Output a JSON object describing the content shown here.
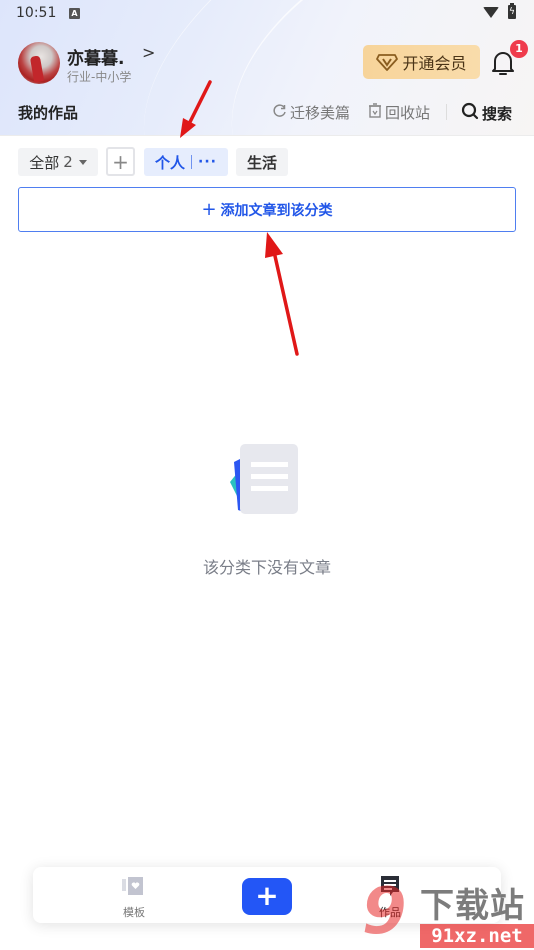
{
  "status_bar": {
    "time": "10:51",
    "notification_icon": "A",
    "wifi": "wifi-icon",
    "battery": "battery-charging-icon"
  },
  "profile": {
    "name": "亦暮暮.",
    "chevron": ">",
    "subtitle": "行业-中小学"
  },
  "vip": {
    "label": "开通会员",
    "icon": "vip-diamond-icon"
  },
  "notifications": {
    "badge_count": "1"
  },
  "section": {
    "title": "我的作品",
    "migrate_label": "迁移美篇",
    "recycle_label": "回收站",
    "search_label": "搜索"
  },
  "categories": {
    "all_label": "全部",
    "all_count": "2",
    "add_symbol": "+",
    "items": [
      {
        "label": "个人",
        "active": true,
        "more": "···"
      },
      {
        "label": "生活",
        "active": false
      }
    ]
  },
  "add_article": {
    "plus": "+",
    "label": "添加文章到该分类"
  },
  "empty_state": {
    "text": "该分类下没有文章"
  },
  "bottom_nav": {
    "items": [
      {
        "label": "模板",
        "icon": "template-icon"
      },
      {
        "label": "作品",
        "icon": "works-icon",
        "active": true
      }
    ],
    "fab_symbol": "+"
  },
  "watermark": {
    "logo": "9",
    "title": "下载站",
    "url": "91xz.net"
  },
  "colors": {
    "accent": "#2156e8",
    "fab": "#2356f6",
    "badge": "#ef3b4c",
    "vip_bg": "#f7d49a",
    "annotation_arrow": "#e01818"
  }
}
